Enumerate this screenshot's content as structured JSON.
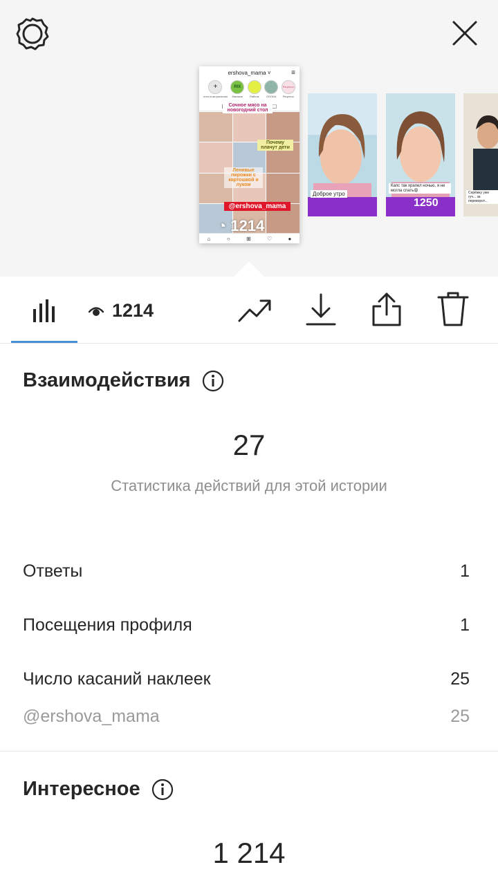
{
  "header": {
    "settings_icon": "gear-icon",
    "close_icon": "close-icon"
  },
  "stories": {
    "selected": {
      "username": "ershova_mama",
      "highlights": [
        "+",
        "RIX",
        "",
        "",
        "Рецепты"
      ],
      "highlight_labels": [
        "ента в актуальном",
        "Магазин",
        "Работа",
        "ОООКА",
        "Рецепты"
      ],
      "stickers": [
        "Сочное мясо на новогодний стол",
        "Почему плачут дети",
        "Ленивые пирожки с картошкой и луком",
        "@ershova_mama"
      ],
      "views": "1214"
    },
    "others": [
      {
        "caption": "Доброе утро",
        "views": ""
      },
      {
        "caption": "Капс так храпел ночью, я не могла спать😩",
        "views": "1250"
      },
      {
        "caption": "Серёжку уже гуч... за переворот...",
        "views": ""
      }
    ]
  },
  "toolbar": {
    "insights_icon": "bar-chart-icon",
    "views_icon": "eye-icon",
    "views": "1214",
    "promote_icon": "trending-up-icon",
    "download_icon": "download-icon",
    "share_icon": "share-icon",
    "delete_icon": "trash-icon"
  },
  "interactions": {
    "title": "Взаимодействия",
    "total": "27",
    "subtitle": "Статистика действий для этой истории",
    "rows": [
      {
        "label": "Ответы",
        "value": "1"
      },
      {
        "label": "Посещения профиля",
        "value": "1"
      },
      {
        "label": "Число касаний наклеек",
        "value": "25"
      }
    ],
    "sub_row": {
      "label": "@ershova_mama",
      "value": "25"
    }
  },
  "discovery": {
    "title": "Интересное",
    "total": "1 214"
  },
  "colors": {
    "tab_accent": "#4a90d9",
    "muted_text": "#8e8e8e",
    "story_band": "#8b2fc9"
  }
}
